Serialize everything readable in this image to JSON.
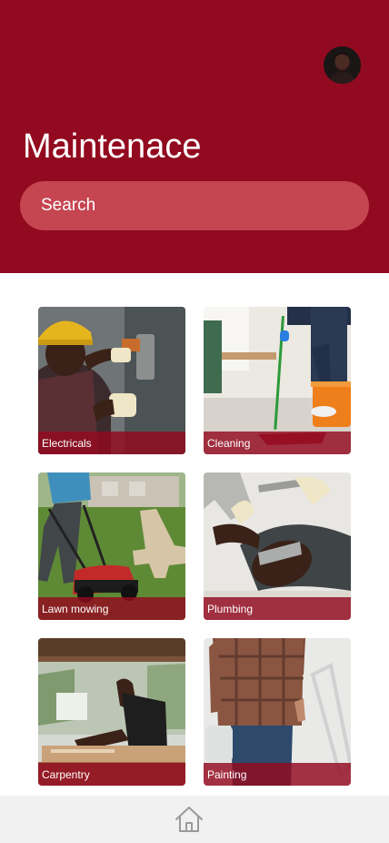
{
  "header": {
    "title": "Maintenace",
    "search_placeholder": "Search",
    "brand_color": "#920a1f"
  },
  "services": [
    {
      "label": "Electricals",
      "icon": "electrician-photo"
    },
    {
      "label": "Cleaning",
      "icon": "cleaning-photo"
    },
    {
      "label": "Lawn mowing",
      "icon": "lawn-mowing-photo"
    },
    {
      "label": "Plumbing",
      "icon": "plumbing-photo"
    },
    {
      "label": "Carpentry",
      "icon": "carpentry-photo"
    },
    {
      "label": "Painting",
      "icon": "painting-photo"
    }
  ],
  "bottom_nav": {
    "home_icon": "home-icon"
  }
}
